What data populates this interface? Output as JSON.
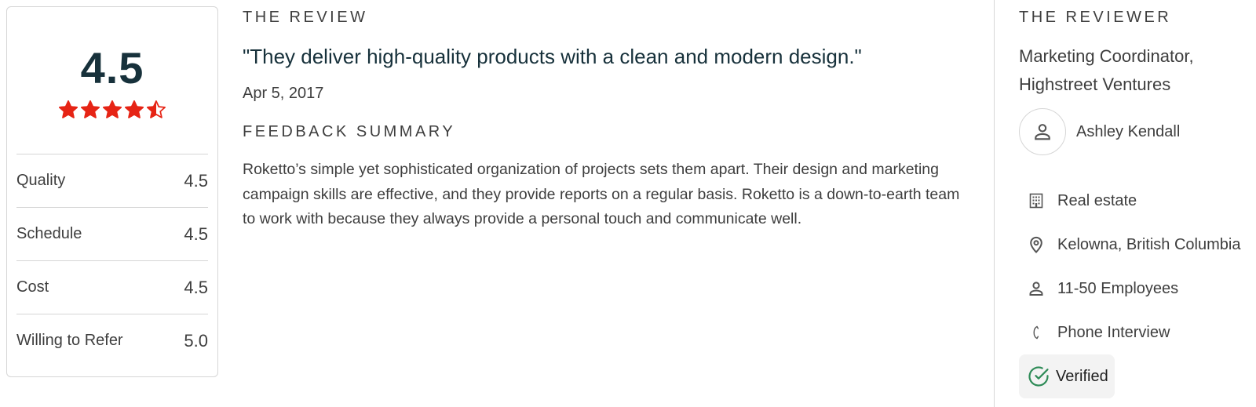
{
  "rating": {
    "overall": "4.5",
    "stars": 4.5,
    "star_color": "#e62415",
    "metrics": [
      {
        "label": "Quality",
        "value": "4.5"
      },
      {
        "label": "Schedule",
        "value": "4.5"
      },
      {
        "label": "Cost",
        "value": "4.5"
      },
      {
        "label": "Willing to Refer",
        "value": "5.0"
      }
    ]
  },
  "review": {
    "heading": "THE REVIEW",
    "quote": "\"They deliver high-quality products with a clean and modern design.\"",
    "date": "Apr 5, 2017",
    "summary_heading": "FEEDBACK SUMMARY",
    "summary": "Roketto’s simple yet sophisticated organization of projects sets them apart. Their design and marketing campaign skills are effective, and they provide reports on a regular basis. Roketto is a down-to-earth team to work with because they always provide a personal touch and communicate well."
  },
  "reviewer": {
    "heading": "THE REVIEWER",
    "title": "Marketing Coordinator, Highstreet Ventures",
    "name": "Ashley Kendall",
    "avatar_icon": "person-icon",
    "details": [
      {
        "icon": "building-icon",
        "text": "Real estate"
      },
      {
        "icon": "location-pin-icon",
        "text": "Kelowna, British Columbia"
      },
      {
        "icon": "person-icon",
        "text": "11-50 Employees"
      },
      {
        "icon": "phone-icon",
        "text": "Phone Interview"
      }
    ],
    "verified": {
      "icon": "check-circle-icon",
      "label": "Verified",
      "color": "#2e8b57"
    }
  }
}
